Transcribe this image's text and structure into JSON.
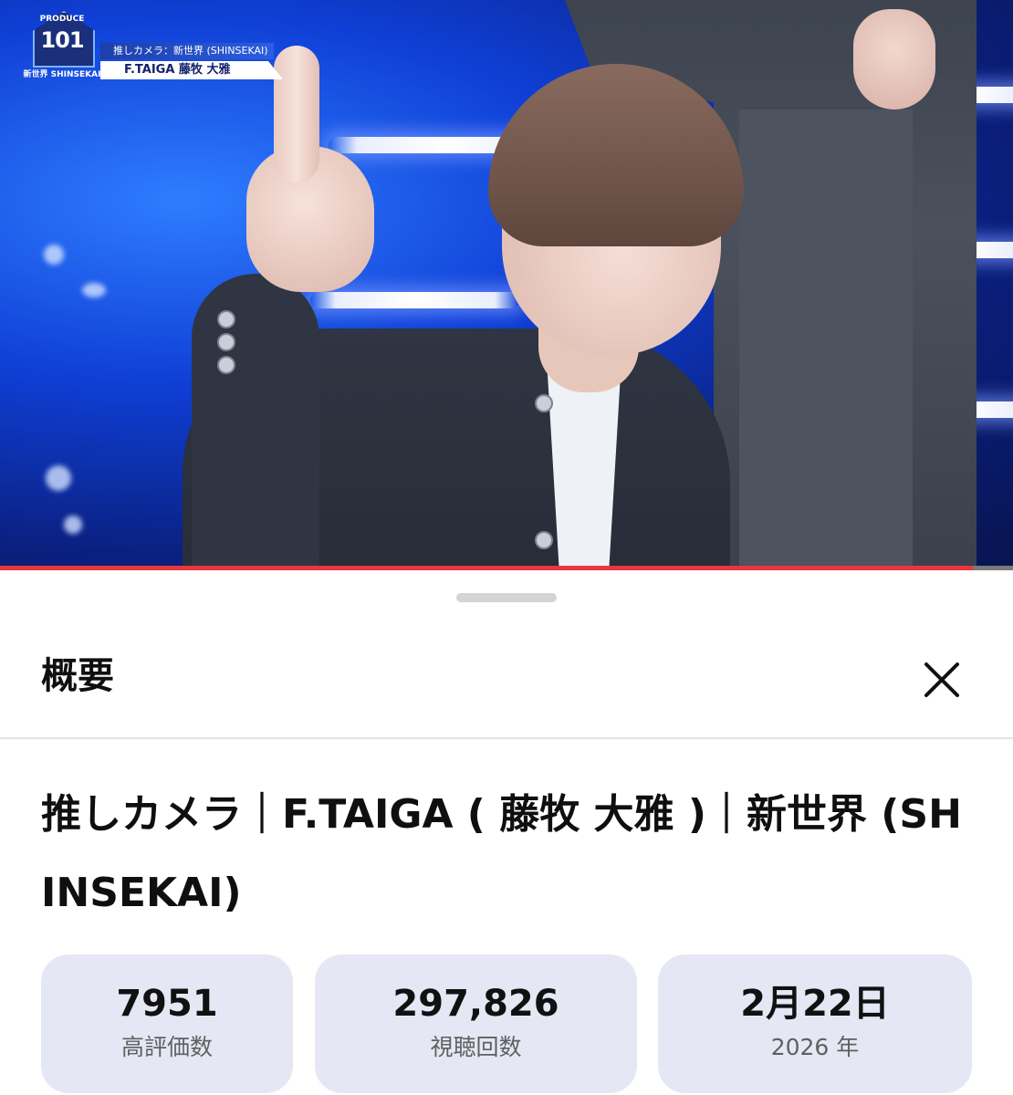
{
  "video": {
    "overlay_logo_top": "PRODUCE",
    "overlay_logo_main": "101",
    "overlay_logo_sub": "新世界 SHINSEKAI",
    "overlay_caption_top": "推しカメラ：新世界 (SHINSEKAI)",
    "overlay_caption_name": "F.TAIGA 藤牧 大雅",
    "progress_fraction": 0.96,
    "progress_color": "#e8383f"
  },
  "sheet": {
    "title": "概要",
    "close_icon": "close-icon",
    "video_title": "推しカメラ｜F.TAIGA ( 藤牧 大雅 )｜新世界 (SHINSEKAI)",
    "stats": [
      {
        "value": "7951",
        "label": "高評価数"
      },
      {
        "value": "297,826",
        "label": "視聴回数"
      },
      {
        "value": "2月22日",
        "label": "2026 年"
      }
    ]
  }
}
